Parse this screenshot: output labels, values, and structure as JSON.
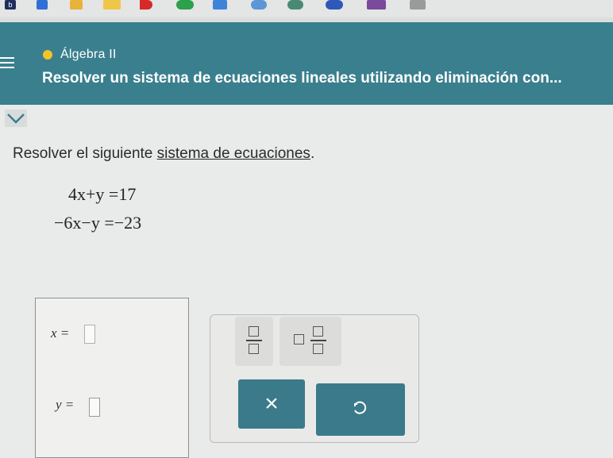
{
  "bookmarks": [
    {
      "name": "bookmark-1",
      "label": "b"
    },
    {
      "name": "bookmark-2"
    },
    {
      "name": "bookmark-3"
    },
    {
      "name": "bookmark-4"
    },
    {
      "name": "bookmark-5"
    },
    {
      "name": "bookmark-6"
    },
    {
      "name": "bookmark-7"
    },
    {
      "name": "bookmark-8"
    },
    {
      "name": "bookmark-9"
    },
    {
      "name": "bookmark-10"
    },
    {
      "name": "bookmark-11"
    },
    {
      "name": "bookmark-12"
    }
  ],
  "header": {
    "course": "Álgebra II",
    "topic": "Resolver un sistema de ecuaciones lineales utilizando eliminación con...",
    "course_dot_color": "#f6c229",
    "background": "#3a7f8e"
  },
  "problem": {
    "prompt_prefix": "Resolver el siguiente ",
    "prompt_link": "sistema de ecuaciones",
    "prompt_suffix": ".",
    "equation_1": "4x+y =17",
    "equation_2": "−6x−y =−23"
  },
  "answer": {
    "x_label": "x =",
    "x_value": "",
    "y_label": "y =",
    "y_value": ""
  },
  "tools": {
    "fraction": "fraction-icon",
    "mixed_number": "mixed-number-icon",
    "clear_label": "×",
    "undo": "undo-icon",
    "accent": "#3b7a8b"
  }
}
